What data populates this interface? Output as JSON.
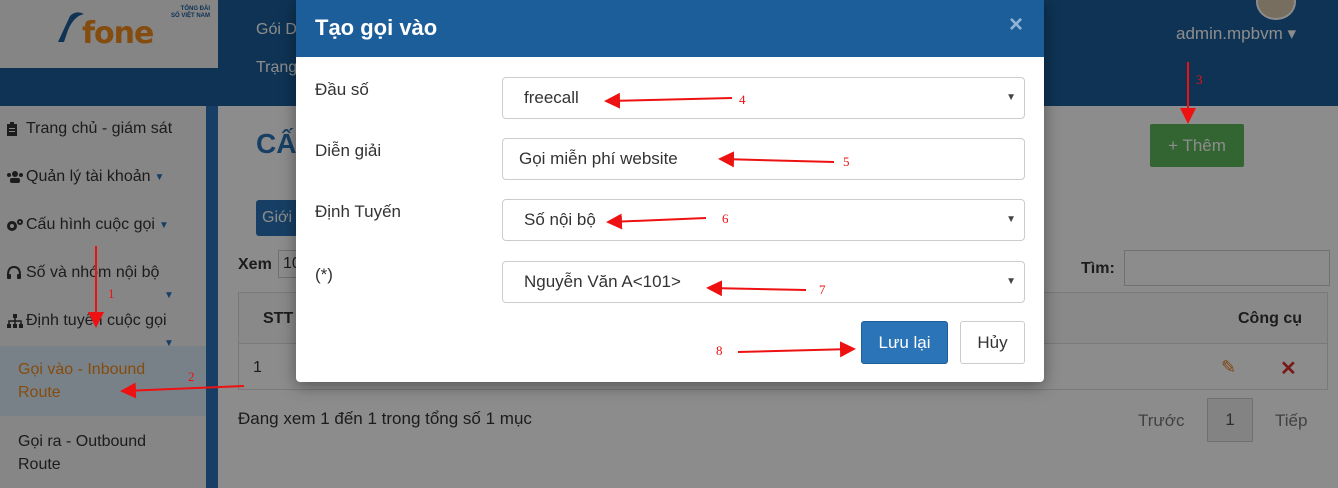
{
  "brand": {
    "logo_text": "fone",
    "logo_small_1": "TỔNG ĐÀI",
    "logo_small_2": "SỐ VIỆT NAM"
  },
  "topnav": {
    "item1": "Gói D",
    "item2": "Trạng"
  },
  "user": {
    "name": "admin.mpbvm"
  },
  "sidebar": {
    "items": [
      {
        "label": "Trang chủ - giám sát",
        "icon": "clipboard-icon"
      },
      {
        "label": "Quản lý tài khoản",
        "icon": "users-icon"
      },
      {
        "label": "Cấu hình cuộc gọi",
        "icon": "gears-icon"
      },
      {
        "label": "Số và nhóm nội bộ",
        "icon": "headset-icon"
      },
      {
        "label": "Định tuyến cuộc gọi",
        "icon": "sitemap-icon"
      }
    ],
    "sub_active": "Gọi vào - Inbound Route",
    "sub_other": "Gọi ra - Outbound Route"
  },
  "page": {
    "title": "CẤU",
    "add_button": "+ Thêm",
    "tab_label": "Giới",
    "show_label": "Xem",
    "show_value": "10",
    "search_label": "Tìm:",
    "table": {
      "headers": [
        "STT",
        "Công cụ"
      ],
      "rows": [
        {
          "stt": "1"
        }
      ]
    },
    "info": "Đang xem 1 đến 1 trong tổng số 1 mục",
    "pager": {
      "prev": "Trước",
      "current": "1",
      "next": "Tiếp"
    }
  },
  "modal": {
    "title": "Tạo gọi vào",
    "close": "×",
    "fields": {
      "prefix": {
        "label": "Đầu số",
        "value": "freecall"
      },
      "description": {
        "label": "Diễn giải",
        "value": "Gọi miễn phí website"
      },
      "routing": {
        "label": "Định Tuyến",
        "value": "Số nội bộ"
      },
      "target": {
        "label": "(*)",
        "value": "Nguyễn Văn A<101>"
      }
    },
    "save": "Lưu lại",
    "cancel": "Hủy"
  },
  "annotations": [
    "1",
    "2",
    "3",
    "4",
    "5",
    "6",
    "7",
    "8"
  ],
  "colors": {
    "header": "#1b5e99",
    "primary": "#2b74b8",
    "success": "#5cb85c",
    "annotation": "#ee1111"
  }
}
